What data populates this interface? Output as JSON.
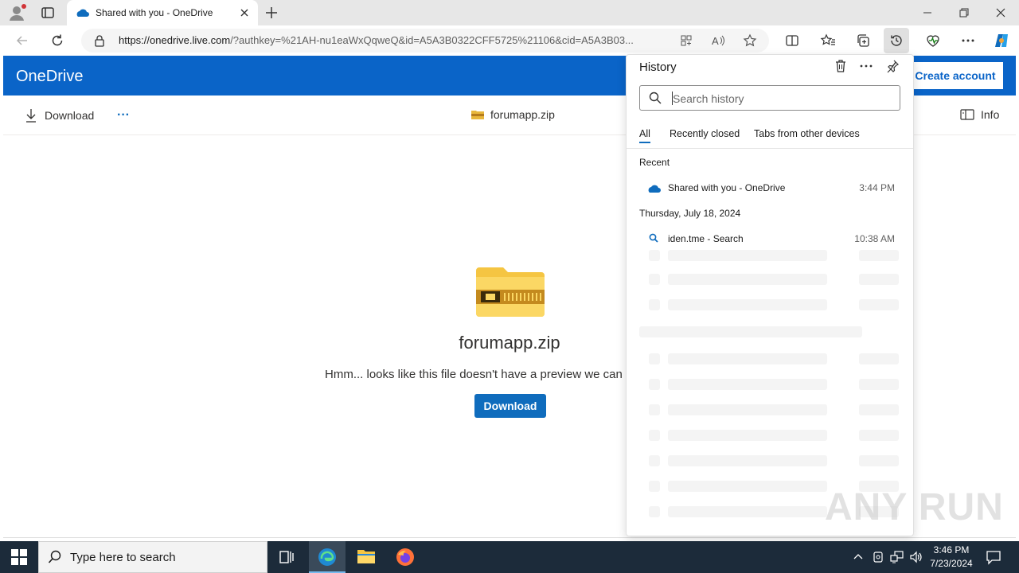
{
  "browser": {
    "tab_title": "Shared with you - OneDrive",
    "url_host": "https://onedrive.live.com",
    "url_rest": "/?authkey=%21AH-nu1eaWxQqweQ&id=A5A3B0322CFF5725%21106&cid=A5A3B03..."
  },
  "app": {
    "name": "OneDrive",
    "create_account": "Create account",
    "toolbar": {
      "download": "Download",
      "more": "···",
      "file_name": "forumapp.zip",
      "info": "Info"
    },
    "preview": {
      "file_name": "forumapp.zip",
      "message": "Hmm... looks like this file doesn't have a preview we can show you.",
      "download_button": "Download"
    }
  },
  "history": {
    "title": "History",
    "search_placeholder": "Search history",
    "tabs": [
      "All",
      "Recently closed",
      "Tabs from other devices"
    ],
    "sections": [
      {
        "label": "Recent",
        "items": [
          {
            "title": "Shared with you - OneDrive",
            "time": "3:44 PM",
            "icon": "onedrive-cloud-icon"
          }
        ]
      },
      {
        "label": "Thursday, July 18, 2024",
        "items": [
          {
            "title": "iden.tme - Search",
            "time": "10:38 AM",
            "icon": "search-icon"
          }
        ]
      }
    ]
  },
  "taskbar": {
    "search_placeholder": "Type here to search",
    "time": "3:46 PM",
    "date": "7/23/2024"
  },
  "watermark": "ANY RUN",
  "colors": {
    "onedrive_blue": "#0a64c8",
    "accent": "#0f6cbd",
    "taskbar": "#1c2b3a"
  }
}
